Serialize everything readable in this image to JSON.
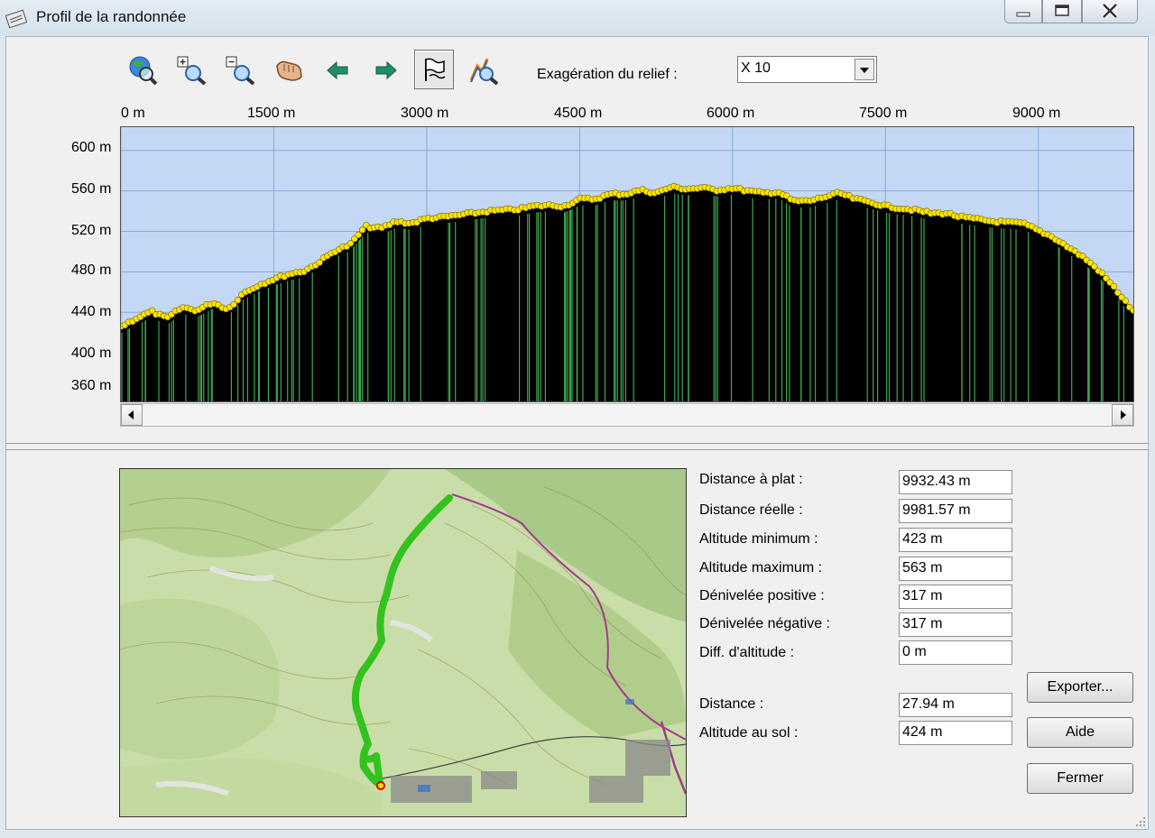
{
  "window": {
    "title": "Profil de la randonnée"
  },
  "toolbar": {
    "tools": [
      {
        "icon": "globe-zoom-icon"
      },
      {
        "icon": "zoom-in-icon"
      },
      {
        "icon": "zoom-out-icon"
      },
      {
        "icon": "pan-hand-icon"
      },
      {
        "icon": "arrow-left-icon"
      },
      {
        "icon": "arrow-right-icon"
      },
      {
        "icon": "flag-icon",
        "active": true
      },
      {
        "icon": "profile-zoom-icon"
      }
    ],
    "exaggeration_label": "Exagération du relief :",
    "exaggeration_value": "X 10"
  },
  "chart_data": {
    "type": "area",
    "x_tick_labels": [
      "0 m",
      "1500 m",
      "3000 m",
      "4500 m",
      "6000 m",
      "7500 m",
      "9000 m"
    ],
    "y_tick_labels": [
      "600 m",
      "560 m",
      "520 m",
      "480 m",
      "440 m",
      "400 m",
      "360 m"
    ],
    "xlim": [
      0,
      9932
    ],
    "ylim": [
      352,
      623
    ],
    "grid": true,
    "colors": {
      "sky": "#c4d8f5",
      "terrain": "#000000",
      "markers": "#ffe600",
      "stripes": "#3fa84f",
      "grid": "#8aa6dc"
    },
    "x": [
      0,
      150,
      300,
      450,
      600,
      750,
      900,
      1050,
      1200,
      1350,
      1500,
      1650,
      1800,
      1950,
      2100,
      2250,
      2400,
      2550,
      2700,
      2850,
      3000,
      3150,
      3300,
      3450,
      3600,
      3750,
      3900,
      4050,
      4200,
      4350,
      4500,
      4650,
      4800,
      4950,
      5100,
      5250,
      5400,
      5550,
      5700,
      5850,
      6000,
      6150,
      6300,
      6450,
      6600,
      6750,
      6900,
      7050,
      7200,
      7350,
      7500,
      7650,
      7800,
      7950,
      8100,
      8250,
      8400,
      8550,
      8700,
      8850,
      9000,
      9150,
      9300,
      9450,
      9600,
      9750,
      9932
    ],
    "y": [
      425,
      433,
      440,
      433,
      444,
      441,
      449,
      442,
      458,
      466,
      472,
      477,
      480,
      489,
      500,
      506,
      524,
      522,
      529,
      527,
      532,
      533,
      535,
      537,
      539,
      540,
      541,
      544,
      545,
      544,
      551,
      551,
      556,
      556,
      560,
      557,
      563,
      561,
      562,
      560,
      562,
      559,
      557,
      558,
      549,
      549,
      553,
      557,
      551,
      548,
      544,
      542,
      540,
      537,
      537,
      533,
      531,
      529,
      528,
      527,
      520,
      513,
      503,
      493,
      480,
      463,
      440
    ]
  },
  "stats": [
    {
      "label": "Distance à plat :",
      "value": "9932.43 m"
    },
    {
      "label": "Distance réelle :",
      "value": "9981.57 m"
    },
    {
      "label": "Altitude minimum :",
      "value": "423 m"
    },
    {
      "label": "Altitude maximum :",
      "value": "563 m"
    },
    {
      "label": "Dénivelée positive :",
      "value": "317 m"
    },
    {
      "label": "Dénivelée négative :",
      "value": "317 m"
    },
    {
      "label": "Diff. d'altitude :",
      "value": "0 m"
    }
  ],
  "cursor": [
    {
      "label": "Distance :",
      "value": "27.94 m"
    },
    {
      "label": "Altitude au sol :",
      "value": "424 m"
    }
  ],
  "buttons": {
    "export": "Exporter...",
    "help": "Aide",
    "close": "Fermer"
  }
}
